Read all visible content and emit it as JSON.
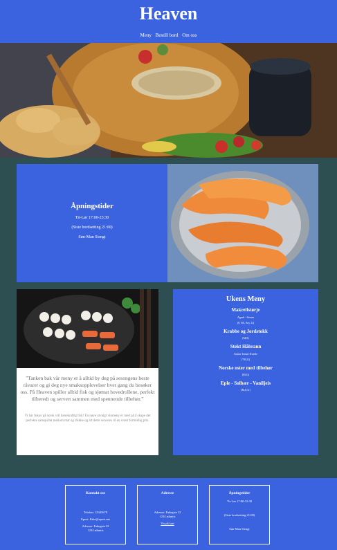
{
  "header": {
    "title": "Heaven",
    "nav": [
      "Meny",
      "Bestill bord",
      "Om oss"
    ]
  },
  "hours": {
    "title": "Åpningstider",
    "line1": "Tir-Lør 17:00-23:30",
    "line2": "(Siste bordsetting 21:00)",
    "line3": "Søn-Man Stengt"
  },
  "quote": {
    "text": "\"Tanken bak vår meny er å alltid by deg på sesongens beste råvarer og gi deg nye smaksopplevelser hver gang du besøker oss. På Heaven spiller alltid fisk og sjømat hovedrollene, perfekt tilberedt og servert sammen med spennende tilbehør.\"",
    "about": "Vi har fokus på norsk vill bærekraftig fisk! En nøye utvalgt vinmeny er med på å skape det perfekte samspillet mellom mat og drikke og alt dette serveres til en svært formidlig pris."
  },
  "menu": {
    "title": "Ukens Meny",
    "dishes": [
      {
        "name": "Makrellstørje",
        "desc": "Agurk - Sesam",
        "allergens": "(F, SE, Soy, G)"
      },
      {
        "name": "Krabbe og Jordstokk",
        "desc": "",
        "allergens": "(M,S)"
      },
      {
        "name": "Stekt Håbrann",
        "desc": "Grønn Tomat-Kvæde",
        "allergens": "(*M,G)"
      },
      {
        "name": "Norske oster med tilbehør",
        "desc": "",
        "allergens": "(M,G)"
      },
      {
        "name": "Eple - Solbær - Vaniljeis",
        "desc": "",
        "allergens": "(M,E,G)"
      }
    ]
  },
  "footer": {
    "contact": {
      "title": "Kontakt oss",
      "phone": "Telefon: 12345678",
      "email": "Epost: Fake@epost.net",
      "address": "Adresse: Fakegata 22",
      "city": "1234 atlantis"
    },
    "address": {
      "title": "Adresse",
      "line1": "Adresse: Fakegata 22",
      "line2": "1234 atlantis",
      "map_link": "Vis på kart"
    },
    "hours": {
      "title": "Åpningstider",
      "line1": "Tir-Lør 17:00-23:30",
      "line2": "(Siste bordsetting 21:00)",
      "line3": "Søn-Man Stengt"
    }
  }
}
